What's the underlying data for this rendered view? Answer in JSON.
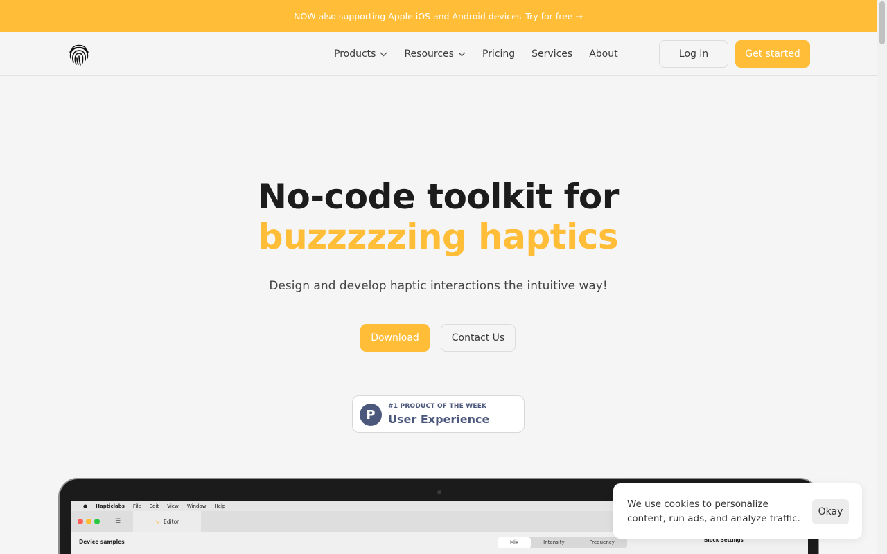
{
  "banner": {
    "text": "NOW also supporting Apple iOS and Android devices",
    "cta": "Try for free →"
  },
  "nav": {
    "logo_icon": "fingerprint-icon",
    "links": [
      {
        "label": "Products",
        "has_dropdown": true
      },
      {
        "label": "Resources",
        "has_dropdown": true
      },
      {
        "label": "Pricing",
        "has_dropdown": false
      },
      {
        "label": "Services",
        "has_dropdown": false
      },
      {
        "label": "About",
        "has_dropdown": false
      }
    ],
    "login": "Log in",
    "get_started": "Get started"
  },
  "hero": {
    "title_line1": "No-code toolkit for",
    "title_line2": "buzzzzzing haptics",
    "subtitle": "Design and develop haptic interactions the intuitive way!",
    "download": "Download",
    "contact": "Contact Us"
  },
  "badge": {
    "icon_letter": "P",
    "top": "#1 PRODUCT OF THE WEEK",
    "main": "User Experience"
  },
  "app_preview": {
    "menu": [
      "Hapticlabs",
      "File",
      "Edit",
      "View",
      "Window",
      "Help"
    ],
    "editor_tab": "Editor",
    "panel_title": "Device samples",
    "segments": [
      "Mix",
      "Intensity",
      "Frequency"
    ],
    "block_settings": "Block Settings"
  },
  "cookie": {
    "text": "We use cookies to personalize content, run ads, and analyze traffic.",
    "button": "Okay"
  },
  "colors": {
    "accent": "#ffbd38",
    "text": "#1c1c1c",
    "background": "#f5f5f5",
    "badge": "#4b587c"
  }
}
